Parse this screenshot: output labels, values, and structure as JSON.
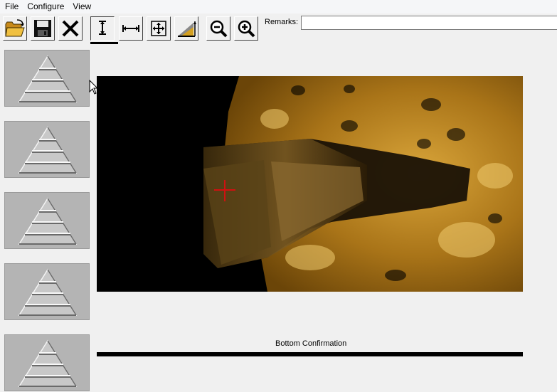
{
  "menu": {
    "file": "File",
    "configure": "Configure",
    "view": "View"
  },
  "toolbar": {
    "buttons": [
      "open-folder-icon",
      "save-icon",
      "delete-icon",
      "vertical-measure-icon",
      "horizontal-measure-icon",
      "move-all-icon",
      "slope-measure-icon",
      "zoom-out-icon",
      "zoom-in-icon"
    ],
    "remarks_label": "Remarks:",
    "remarks_value": ""
  },
  "thumbnails": [
    {
      "icon": "pyramid-icon"
    },
    {
      "icon": "pyramid-icon"
    },
    {
      "icon": "pyramid-icon"
    },
    {
      "icon": "pyramid-icon"
    },
    {
      "icon": "pyramid-icon"
    }
  ],
  "viewer": {
    "image_desc": "side-scan sonar image of shipwreck",
    "bottom_label": "Bottom Confirmation",
    "accent_color": "#c8921c",
    "crosshair_color": "#d01010"
  }
}
